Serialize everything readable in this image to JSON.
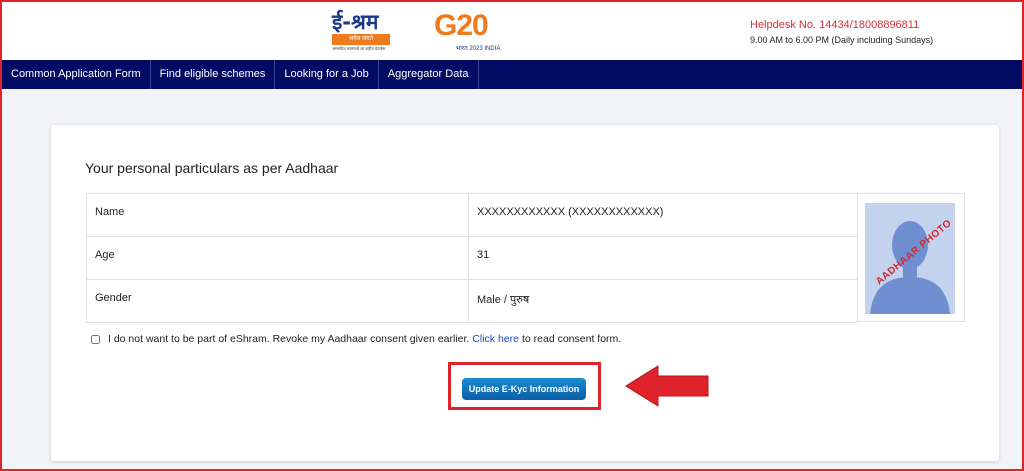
{
  "header": {
    "logo_hindi": "ई-श्रम",
    "logo_band": "श्रमेव जयते",
    "logo_tagline": "असंगठित कामगारों का राष्ट्रीय डेटाबेस",
    "g20_text": "G20",
    "g20_year": "भारत 2023 INDIA",
    "helpdesk": "Helpdesk No. 14434/18008896811",
    "hours": "9.00 AM to 6.00 PM (Daily including Sundays)"
  },
  "nav": {
    "items": [
      {
        "label": "Common Application Form"
      },
      {
        "label": "Find eligible schemes"
      },
      {
        "label": "Looking for a Job"
      },
      {
        "label": "Aggregator Data"
      }
    ]
  },
  "card": {
    "title": "Your personal particulars as per Aadhaar",
    "rows": [
      {
        "label": "Name",
        "value": "XXXXXXXXXXXX (XXXXXXXXXXXX)"
      },
      {
        "label": "Age",
        "value": "31"
      },
      {
        "label": "Gender",
        "value": "Male / पुरुष"
      }
    ],
    "photo_label": "AADHAAR PHOTO",
    "consent_text_before": "I do not want to be part of eShram. Revoke my Aadhaar consent given earlier.",
    "consent_link": "Click here",
    "consent_text_after": "to read consent form.",
    "consent_checked": false,
    "update_button": "Update E-Kyc Information"
  },
  "colors": {
    "navbar": "#010b63",
    "highlight": "#e0222b",
    "button": "#0b5fa8"
  }
}
